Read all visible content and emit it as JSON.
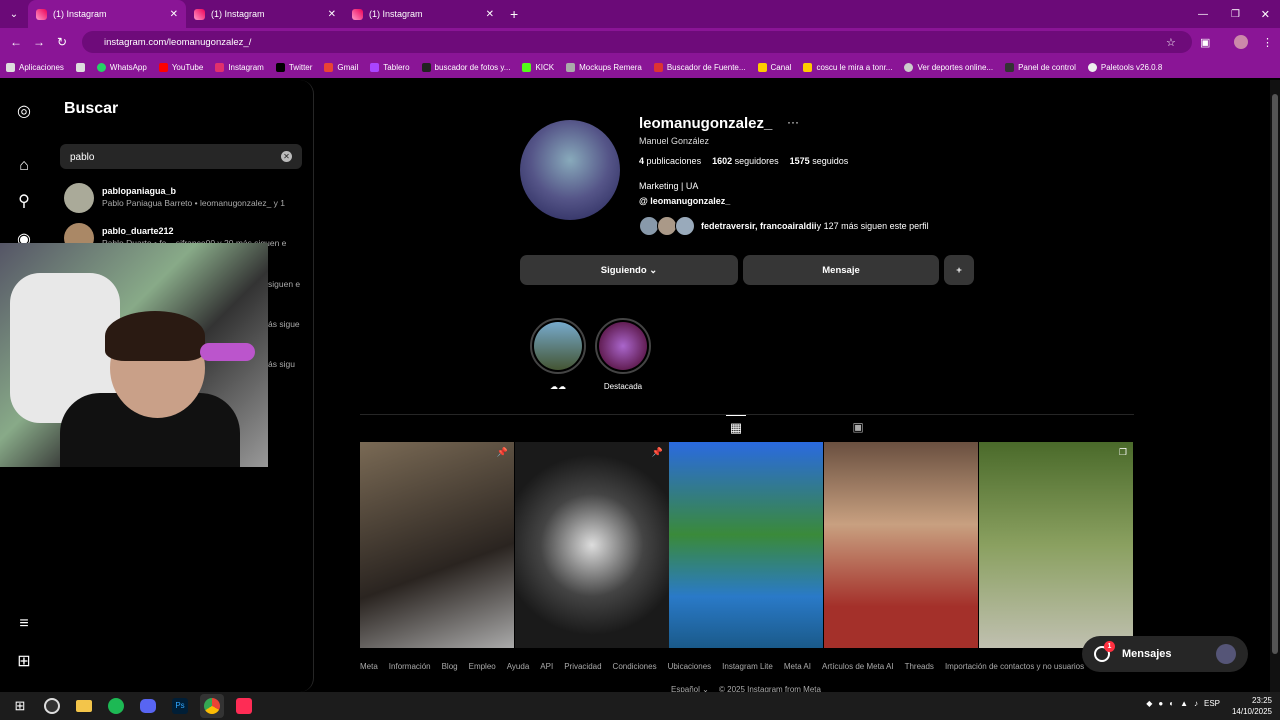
{
  "browser": {
    "tabs": [
      {
        "title": "(1) Instagram"
      },
      {
        "title": "(1) Instagram"
      },
      {
        "title": "(1) Instagram"
      }
    ],
    "url": "instagram.com/leomanugonzalez_/",
    "bookmarks": [
      "Aplicaciones",
      "WhatsApp",
      "YouTube",
      "Instagram",
      "Twitter",
      "Gmail",
      "Tablero",
      "buscador de fotos y...",
      "KICK",
      "Mockups Remera",
      "Buscador de Fuente...",
      "Canal",
      "coscu le mira a tonr...",
      "Ver deportes online...",
      "Panel de control",
      "Paletools v26.0.8"
    ]
  },
  "search": {
    "title": "Buscar",
    "value": "pablo",
    "results": [
      {
        "username": "pablopaniagua_b",
        "desc": "Pablo Paniagua Barreto • leomanugonzalez_ y 1"
      },
      {
        "username": "pablo_duarte212",
        "desc": "Pablo Duarte • fe... sifrance00 y 20 más siguen e"
      }
    ],
    "partial_texts": [
      "siguen e",
      "ás sigue",
      "ás sigu"
    ]
  },
  "profile": {
    "username": "leomanugonzalez_",
    "more": "···",
    "full_name": "Manuel González",
    "posts_count": "4",
    "posts_label": "publicaciones",
    "followers_count": "1602",
    "followers_label": "seguidores",
    "following_count": "1575",
    "following_label": "seguidos",
    "bio": "Marketing | UA",
    "threads_handle": "leomanugonzalez_",
    "followed_by_names": "fedetraversir, francoairaldii",
    "followed_by_rest": " y 127 más siguen este perfil",
    "following_button": "Siguiendo ⌄",
    "message_button": "Mensaje",
    "add_icon": "+",
    "highlights": [
      {
        "label": "☁☁"
      },
      {
        "label": "Destacada"
      }
    ]
  },
  "footer": {
    "links": [
      "Meta",
      "Información",
      "Blog",
      "Empleo",
      "Ayuda",
      "API",
      "Privacidad",
      "Condiciones",
      "Ubicaciones",
      "Instagram Lite",
      "Meta AI",
      "Artículos de Meta AI",
      "Threads",
      "Importación de contactos y no usuarios"
    ],
    "language": "Español ⌄",
    "copyright": "© 2025 Instagram from Meta"
  },
  "messages": {
    "label": "Mensajes",
    "badge": "1"
  },
  "taskbar": {
    "lang": "ESP",
    "time": "23:25",
    "date": "14/10/2025"
  }
}
